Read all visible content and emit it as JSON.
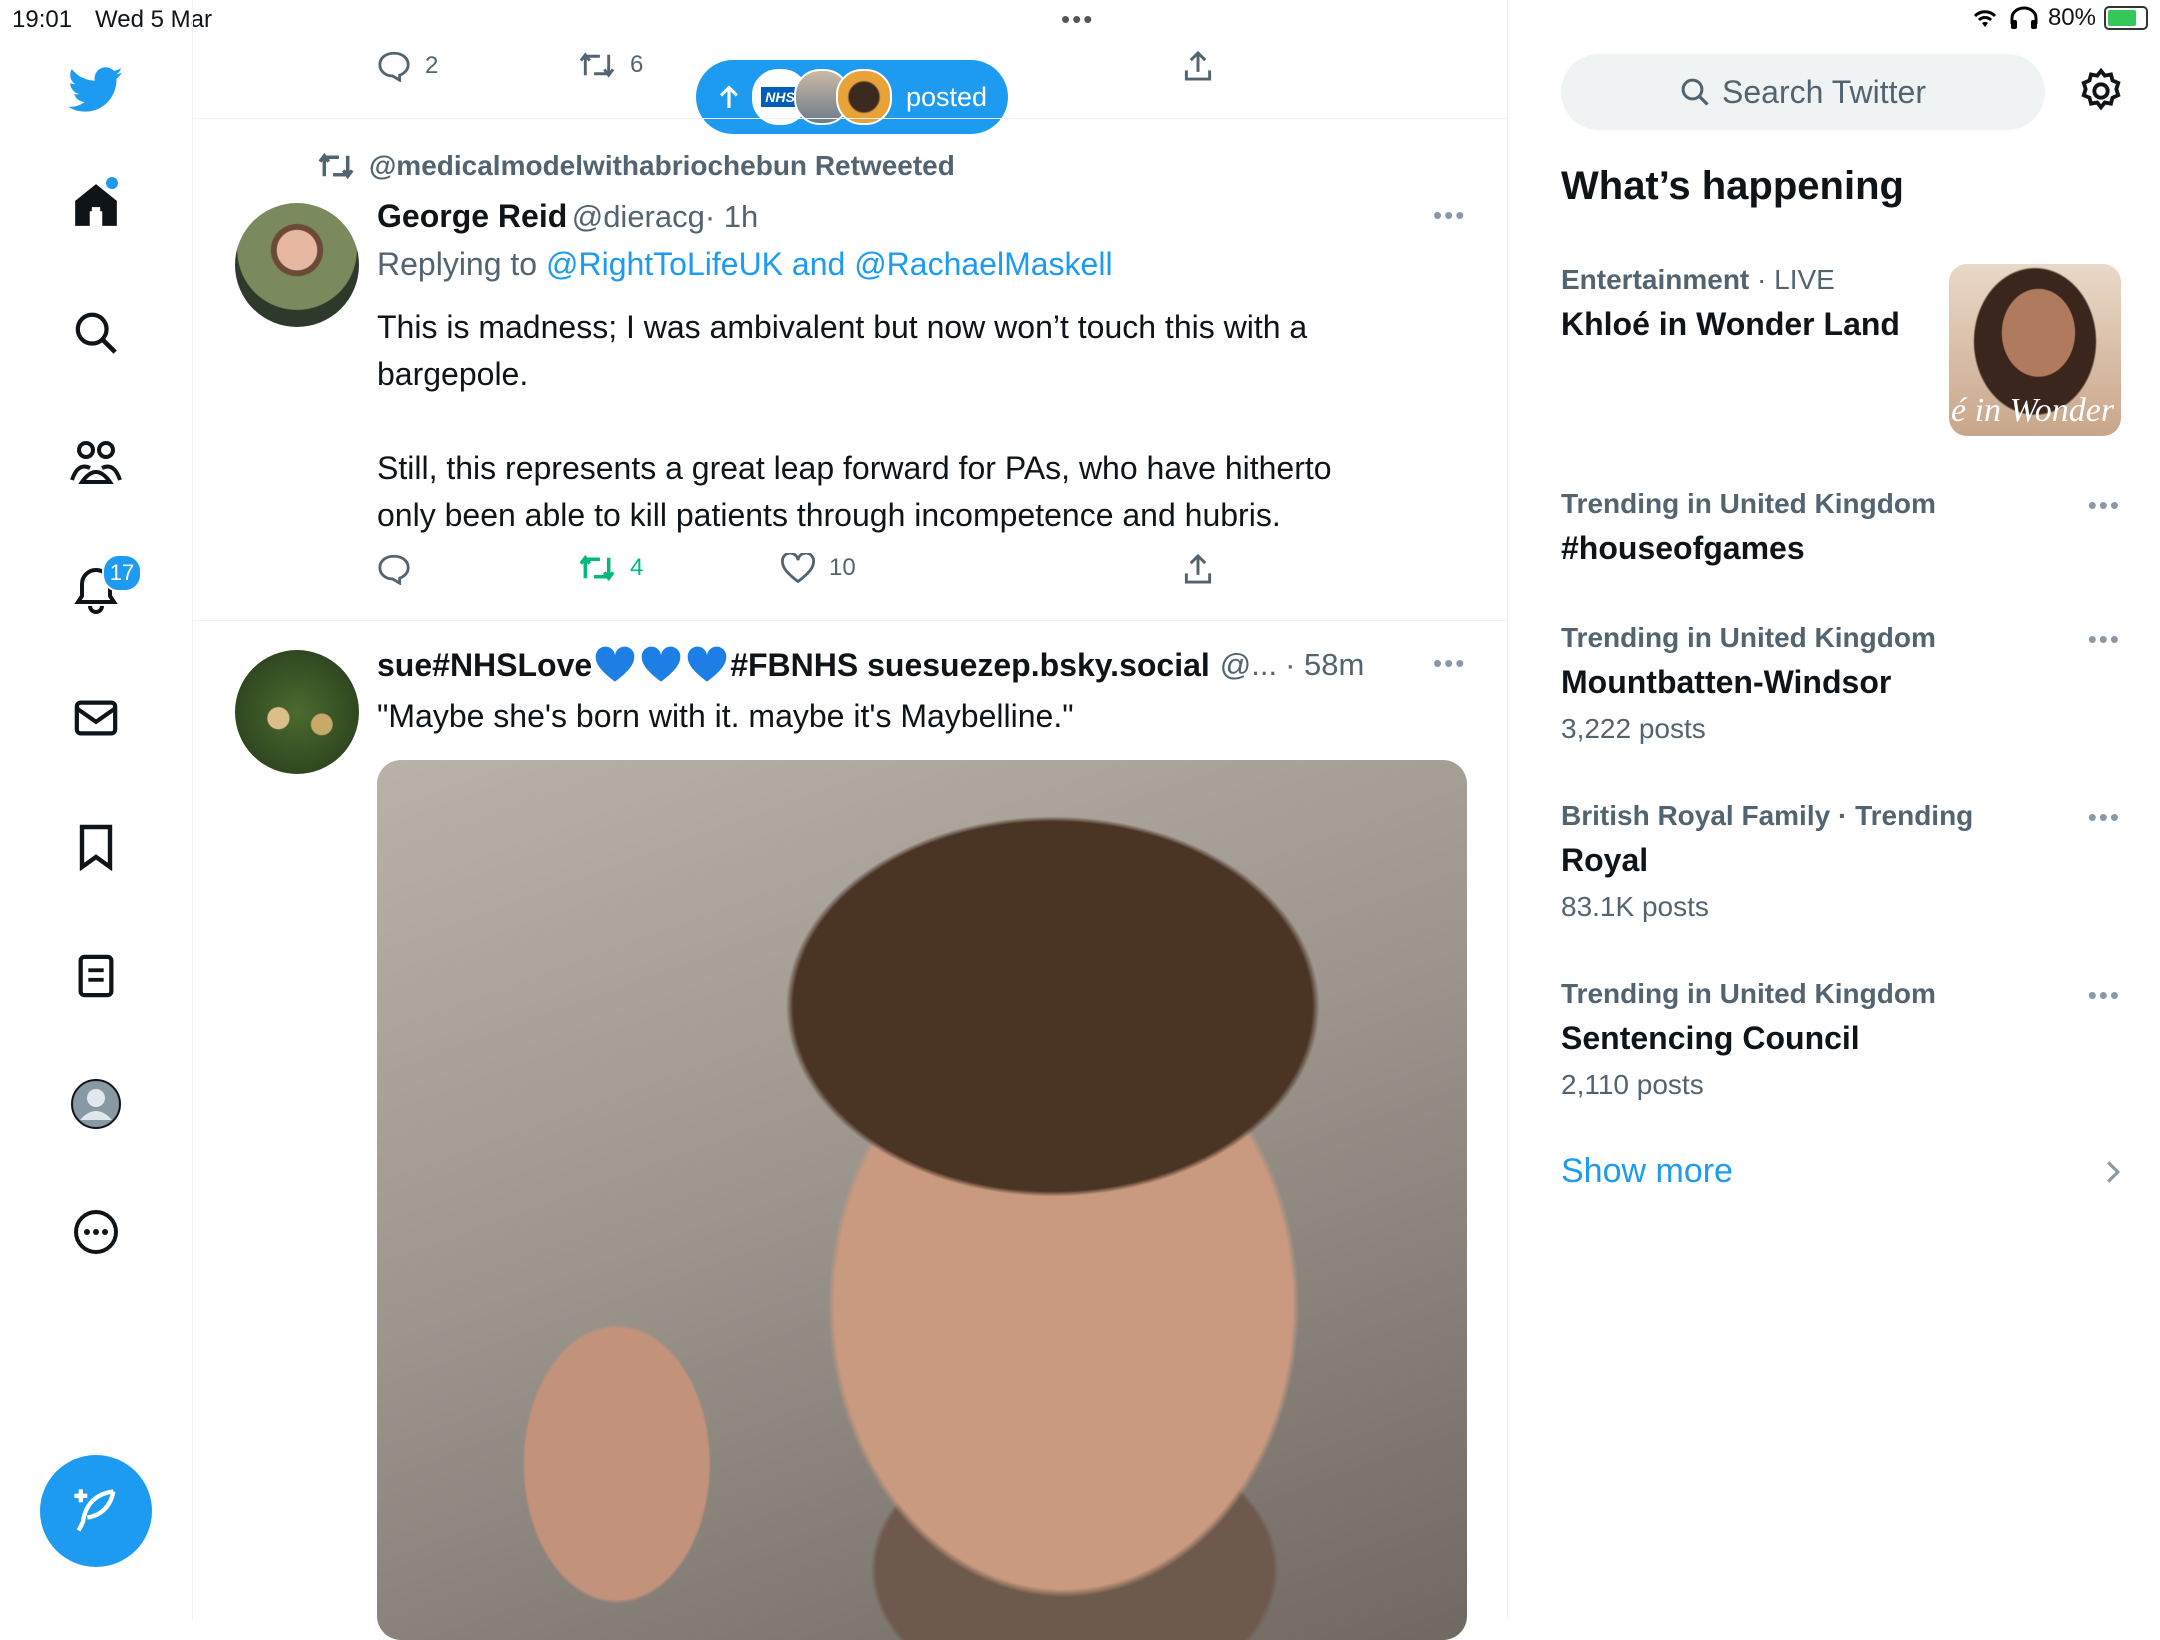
{
  "status_bar": {
    "time": "19:01",
    "date": "Wed 5 Mar",
    "battery": "80%",
    "battery_level": 0.8
  },
  "nav": {
    "items": [
      "home-icon",
      "explore-icon",
      "communities-icon",
      "notifications-icon",
      "messages-icon",
      "bookmarks-icon",
      "lists-icon",
      "profile-icon",
      "more-icon"
    ],
    "notifications_badge": "17"
  },
  "colors": {
    "accent": "#1d9bf0",
    "retweet_green": "#00ba7c",
    "secondary_text": "#536471"
  },
  "top_tweet_actions": {
    "replies": "2",
    "retweets": "6"
  },
  "new_posts_pill": {
    "label": "posted"
  },
  "tweet1": {
    "retweeted_by": "@medicalmodelwithabriochebun Retweeted",
    "name": "George Reid",
    "handle": "@dieracg",
    "time": "· 1h",
    "replying_prefix": "Replying to ",
    "replying_to": "@RightToLifeUK and @RachaelMaskell",
    "text_p1_line1": "This is madness; I was ambivalent but now won’t touch this with a",
    "text_p1_line2": "bargepole.",
    "text_p2_line1": "Still, this represents a great leap forward for PAs, who have hitherto",
    "text_p2_line2": "only been able to kill patients through incompetence and hubris.",
    "retweets": "4",
    "likes": "10"
  },
  "tweet2": {
    "name_prefix": "sue#NHSLove",
    "name_suffix": "#FBNHS suesuezep.bsky.social",
    "handle": "@...",
    "time": "· 58m",
    "text": "\"Maybe she's born with it. maybe it's Maybelline.\""
  },
  "sidebar": {
    "search_placeholder": "Search Twitter",
    "title": "What’s happening",
    "featured": {
      "category": "Entertainment",
      "live": "· LIVE",
      "title": "Khloé in Wonder Land",
      "thumb_text": "é in Wonder l"
    },
    "trends": [
      {
        "category": "Trending in United Kingdom",
        "title": "#houseofgames",
        "count": ""
      },
      {
        "category": "Trending in United Kingdom",
        "title": "Mountbatten-Windsor",
        "count": "3,222 posts"
      },
      {
        "category": "British Royal Family · Trending",
        "title": "Royal",
        "count": "83.1K posts"
      },
      {
        "category": "Trending in United Kingdom",
        "title": "Sentencing Council",
        "count": "2,110 posts"
      }
    ],
    "show_more": "Show more"
  }
}
